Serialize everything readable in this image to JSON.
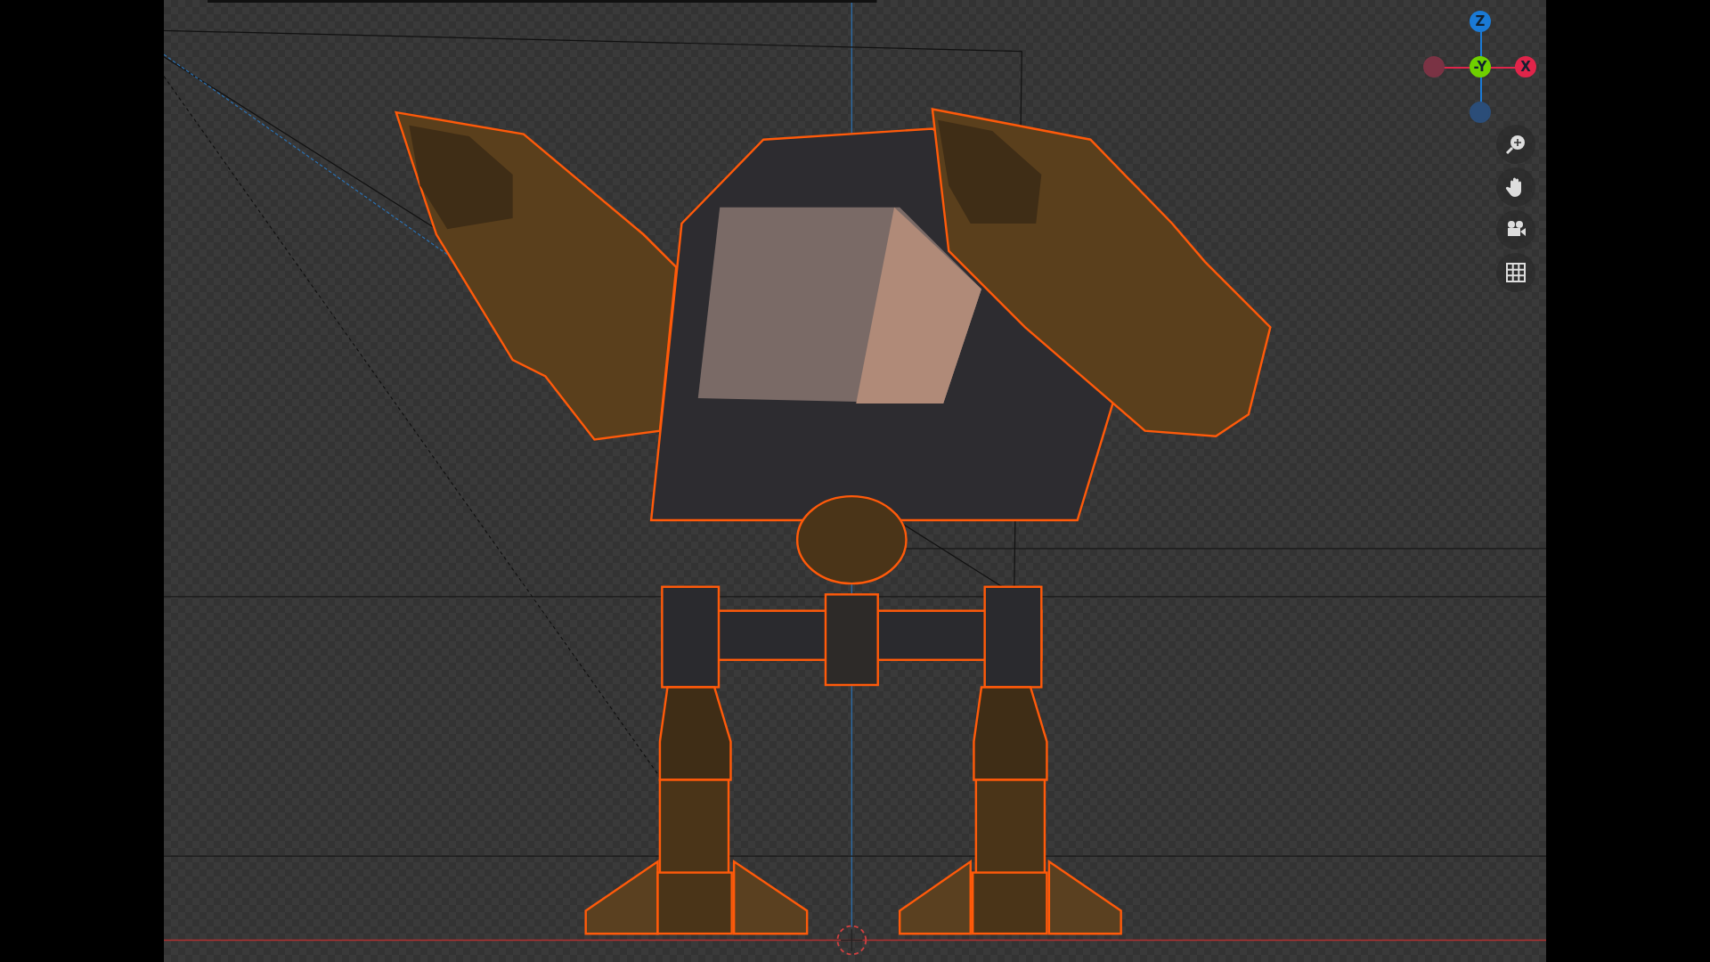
{
  "viewport": {
    "gizmo": {
      "axes": [
        {
          "kind": "labeled",
          "label": "Z",
          "color": "#1a7ad6"
        },
        {
          "kind": "unlabeled",
          "color": "#7a3344"
        },
        {
          "kind": "labeled",
          "label": "-Y",
          "color": "#6fd000"
        },
        {
          "kind": "labeled",
          "label": "X",
          "color": "#e0254a"
        },
        {
          "kind": "unlabeled",
          "color": "#2b4d78"
        }
      ]
    }
  }
}
